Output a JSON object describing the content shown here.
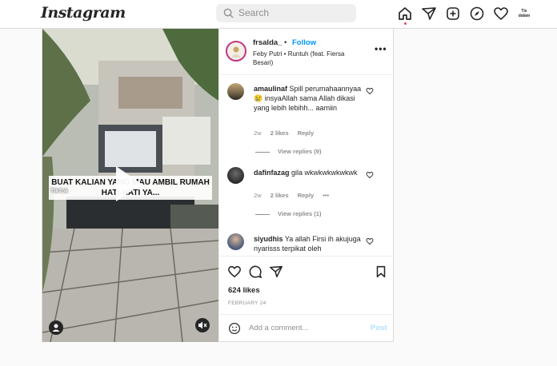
{
  "header": {
    "logo": "Instagram",
    "search_placeholder": "Search",
    "profile_avatar_text": "Tix dalam",
    "icons": [
      "home-icon",
      "direct-messages-icon",
      "new-post-icon",
      "explore-icon",
      "activity-heart-icon",
      "profile-avatar"
    ]
  },
  "media": {
    "caption_line1": "BUAT KALIAN YANG MAU AMBIL RUMAH",
    "caption_line2": "HATI-HATI YA...",
    "watermark": "TikTok"
  },
  "post_header": {
    "username": "frsalda_",
    "separator": "•",
    "follow": "Follow",
    "audio": "Feby Putri • Runtuh (feat. Fiersa Besari)",
    "more": "•••"
  },
  "comments": [
    {
      "username": "amaulinaf",
      "text": "Spill perumahaannyaa 😢 insyaAllah sama Allah dikasi yang lebih lebihh... aamiin",
      "time": "2w",
      "likes": "2 likes",
      "reply": "Reply",
      "view_replies": "View replies (9)",
      "avatar_color": "#7a6a4f"
    },
    {
      "username": "dafinfazag",
      "text": "gila wkwkwkwkwkwk",
      "time": "2w",
      "likes": "2 likes",
      "reply": "Reply",
      "more": "•••",
      "view_replies": "View replies (1)",
      "avatar_color": "#3a3a3a"
    },
    {
      "username": "siyudhis",
      "text": "Ya allah Firsi ih akujuga nyarisss terpikat oleh",
      "avatar_color": "#4a5a7a"
    }
  ],
  "actions": {
    "likes": "624 likes",
    "date": "FEBRUARY 24"
  },
  "add_comment": {
    "placeholder": "Add a comment...",
    "post_label": "Post"
  },
  "colors": {
    "link_blue": "#0095f6",
    "post_disabled": "#b2dffc",
    "notification_dot": "#ed4956",
    "story_ring": "#c13584"
  }
}
